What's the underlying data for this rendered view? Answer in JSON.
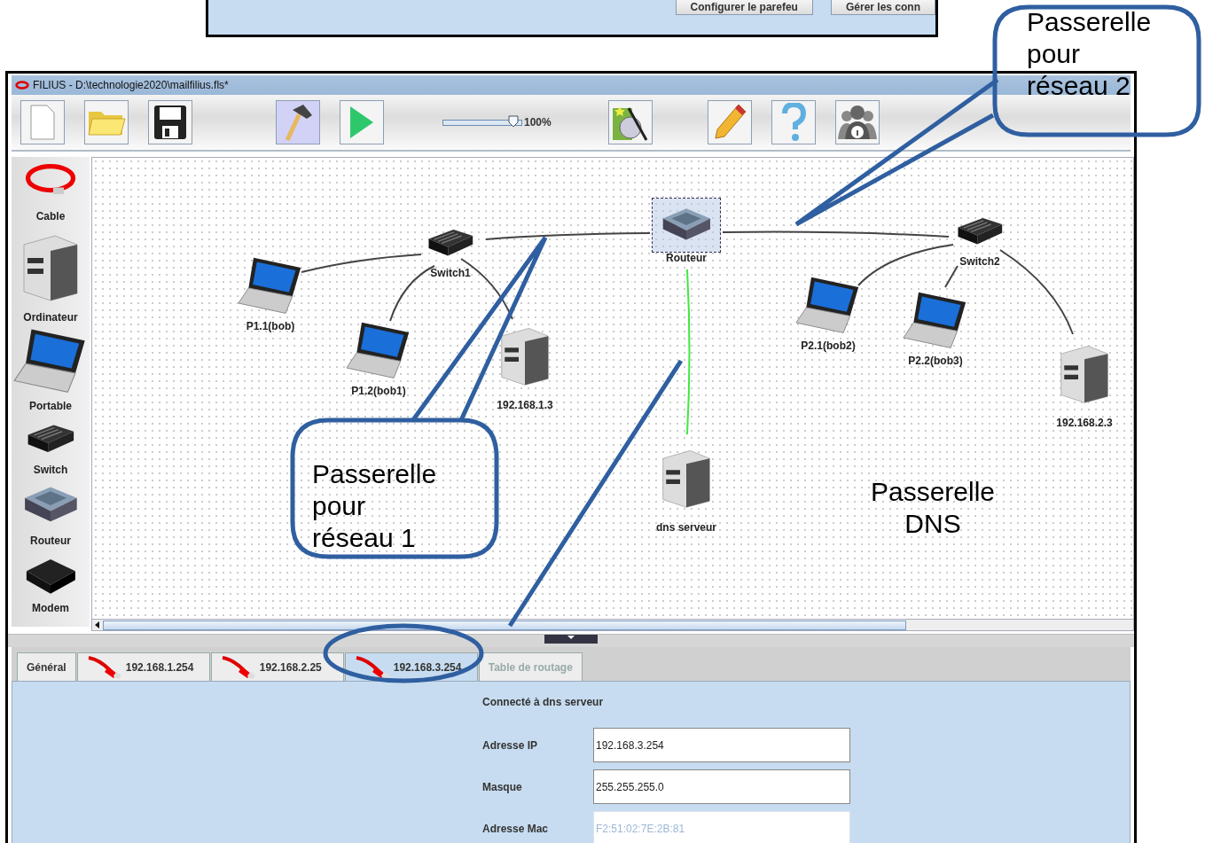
{
  "background_window": {
    "buttons": [
      "Configurer le parefeu",
      "Gérer les conn"
    ]
  },
  "window": {
    "title": "FILIUS - D:\\technologie2020\\mailfilius.fls*"
  },
  "toolbar": {
    "tools": [
      {
        "kind": "new",
        "selected": false
      },
      {
        "kind": "open",
        "selected": false
      },
      {
        "kind": "save",
        "selected": false
      },
      {
        "kind": "design",
        "selected": true
      },
      {
        "kind": "run",
        "selected": false
      }
    ],
    "zoom": {
      "level": 0.9,
      "reading": "100%"
    },
    "tools_right": [
      {
        "kind": "wizard"
      },
      {
        "kind": "edit"
      },
      {
        "kind": "help"
      },
      {
        "kind": "about"
      }
    ]
  },
  "palette": [
    {
      "label": "Cable",
      "kind": "cable"
    },
    {
      "label": "Ordinateur",
      "kind": "server"
    },
    {
      "label": "Portable",
      "kind": "laptop"
    },
    {
      "label": "Switch",
      "kind": "switch"
    },
    {
      "label": "Routeur",
      "kind": "router"
    },
    {
      "label": "Modem",
      "kind": "modem"
    }
  ],
  "canvas": {
    "nodes": [
      {
        "label": "P1.1(bob)",
        "kind": "laptop",
        "selected": false
      },
      {
        "label": "Switch1",
        "kind": "switch",
        "selected": false
      },
      {
        "label": "P1.2(bob1)",
        "kind": "laptop",
        "selected": false
      },
      {
        "label": "192.168.1.3",
        "kind": "server",
        "selected": false
      },
      {
        "label": "Routeur",
        "kind": "router",
        "selected": true
      },
      {
        "label": "dns serveur",
        "kind": "server",
        "selected": false
      },
      {
        "label": "Switch2",
        "kind": "switch",
        "selected": false
      },
      {
        "label": "P2.1(bob2)",
        "kind": "laptop",
        "selected": false
      },
      {
        "label": "P2.2(bob3)",
        "kind": "laptop",
        "selected": false
      },
      {
        "label": "192.168.2.3",
        "kind": "server",
        "selected": false
      }
    ],
    "links": [
      {
        "highlighted": false
      },
      {
        "highlighted": false
      },
      {
        "highlighted": false
      },
      {
        "highlighted": false
      },
      {
        "highlighted": true
      },
      {
        "highlighted": false
      },
      {
        "highlighted": false
      },
      {
        "highlighted": false
      },
      {
        "highlighted": false
      }
    ]
  },
  "tabs": [
    {
      "label": "Général",
      "kind": "general",
      "selected": false,
      "disabled": false
    },
    {
      "label": "192.168.1.254",
      "kind": "interface",
      "selected": false,
      "disabled": false
    },
    {
      "label": "192.168.2.25",
      "kind": "interface",
      "selected": false,
      "disabled": false
    },
    {
      "label": "192.168.3.254",
      "kind": "interface",
      "selected": true,
      "disabled": false
    },
    {
      "label": "Table de routage",
      "kind": "general",
      "selected": false,
      "disabled": true
    }
  ],
  "panel": {
    "heading": "Connecté à dns serveur",
    "fields": [
      {
        "label": "Adresse IP",
        "value": "192.168.3.254",
        "disabled": false
      },
      {
        "label": "Masque",
        "value": "255.255.255.0",
        "disabled": false
      },
      {
        "label": "Adresse Mac",
        "value": "F2:51:02:7E:2B:81",
        "disabled": true
      }
    ]
  },
  "annotations": [
    {
      "text": "Passerelle pour réseau 2",
      "kind": "callout"
    },
    {
      "text": "Passerelle pour réseau 1",
      "kind": "callout"
    },
    {
      "text": "Passerelle DNS",
      "kind": "pointer"
    },
    {
      "kind": "ellipse"
    }
  ]
}
